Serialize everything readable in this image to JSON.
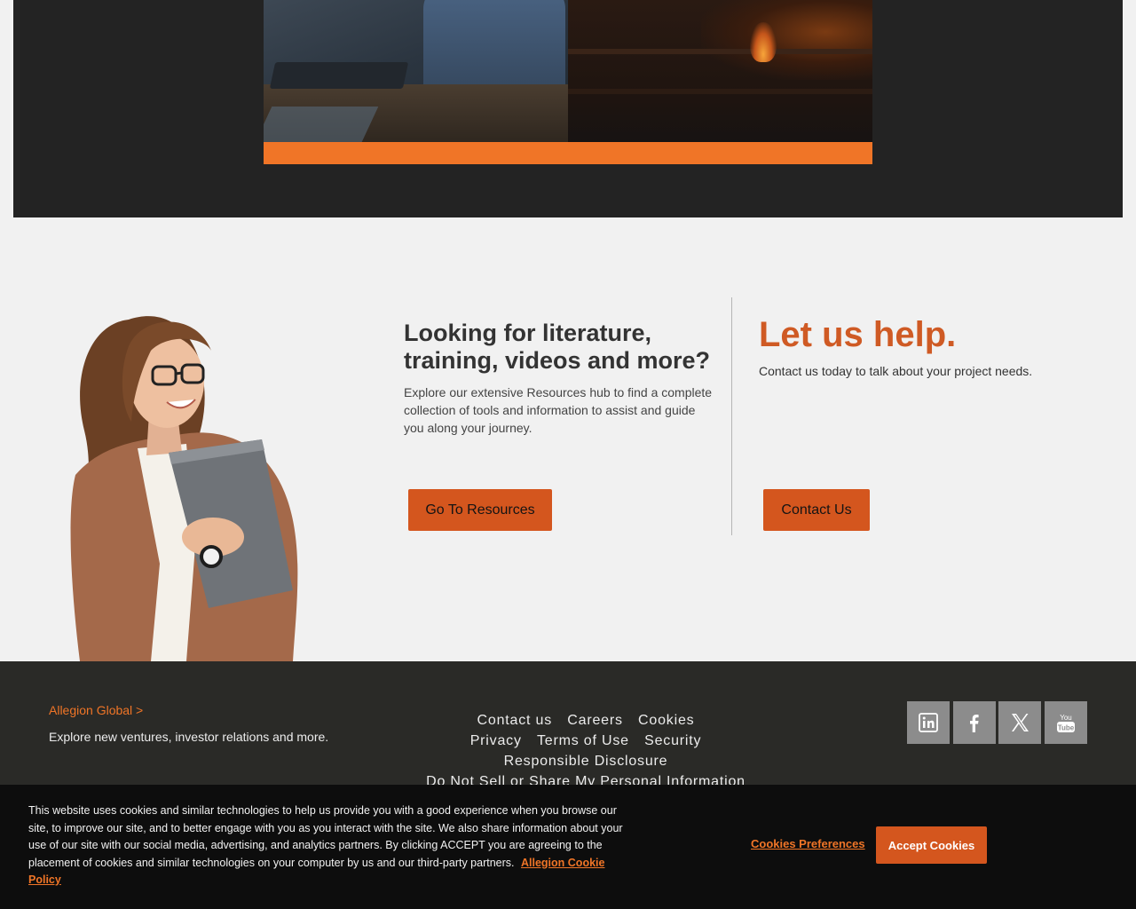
{
  "literature": {
    "title": "Looking for literature, training, videos and more?",
    "description": "Explore our extensive Resources hub to find a complete collection of tools and information to assist and guide you along your journey.",
    "button": "Go To Resources"
  },
  "help": {
    "title": "Let us help.",
    "description": "Contact us today to talk about your project needs.",
    "button": "Contact Us"
  },
  "footer": {
    "global_link": "Allegion Global >",
    "global_desc": "Explore new ventures, investor relations and more.",
    "links": [
      "Contact us",
      "Careers",
      "Cookies",
      "Privacy",
      "Terms of Use",
      "Security",
      "Responsible Disclosure",
      "Do Not Sell or Share My Personal Information"
    ],
    "social": [
      "linkedin-icon",
      "facebook-icon",
      "x-icon",
      "youtube-icon"
    ]
  },
  "cookie": {
    "text": "This website uses cookies and similar technologies to help us provide you with a good experience when you browse our site, to improve our site, and to better engage with you as you interact with the site. We also share information about your use of our site with our social media, advertising, and analytics partners. By clicking ACCEPT you are agreeing to the placement of cookies and similar technologies on your computer by us and our third-party partners.",
    "policy_link": "Allegion Cookie Policy",
    "preferences": "Cookies Preferences",
    "accept": "Accept Cookies"
  },
  "colors": {
    "accent": "#f07527",
    "button": "#d4561e",
    "dark": "#232323",
    "footer": "#2a2a27"
  }
}
